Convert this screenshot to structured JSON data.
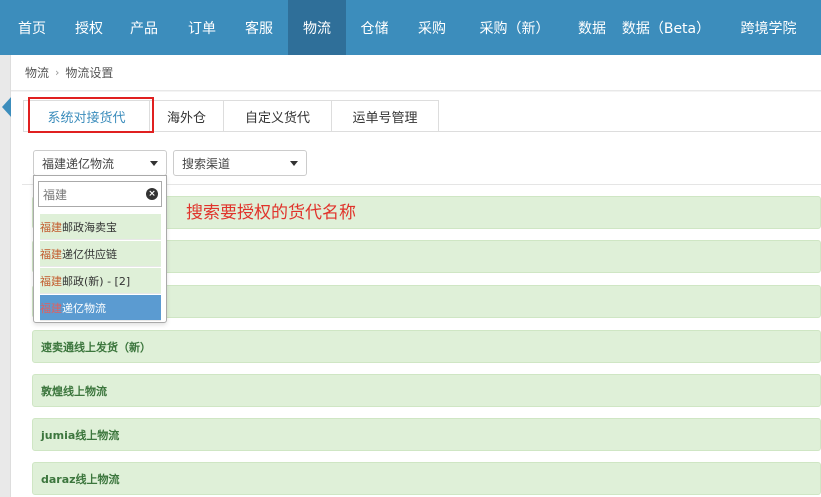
{
  "nav": {
    "items": [
      {
        "label": "首页",
        "active": false
      },
      {
        "label": "授权",
        "active": false
      },
      {
        "label": "产品",
        "active": false
      },
      {
        "label": "订单",
        "active": false
      },
      {
        "label": "客服",
        "active": false
      },
      {
        "label": "物流",
        "active": true
      },
      {
        "label": "仓储",
        "active": false
      },
      {
        "label": "采购",
        "active": false
      },
      {
        "label": "采购（新）",
        "active": false
      },
      {
        "label": "数据",
        "active": false
      },
      {
        "label": "数据（Beta）",
        "active": false
      },
      {
        "label": "跨境学院",
        "active": false
      }
    ]
  },
  "breadcrumb": {
    "root": "物流",
    "current": "物流设置"
  },
  "tabs": [
    "系统对接货代",
    "海外仓",
    "自定义货代",
    "运单号管理"
  ],
  "filters": {
    "carrier_select": "福建递亿物流",
    "channel_select": "搜索渠道"
  },
  "dropdown": {
    "search_value": "福建",
    "options": [
      {
        "highlight": "福建",
        "rest": "邮政海卖宝",
        "selected": false
      },
      {
        "highlight": "福建",
        "rest": "递亿供应链",
        "selected": false
      },
      {
        "highlight": "福建",
        "rest": "邮政(新) - [2]",
        "selected": false
      },
      {
        "highlight": "福建",
        "rest": "递亿物流",
        "selected": true
      }
    ]
  },
  "annotation": "搜索要授权的货代名称",
  "rows": [
    "速卖通线上发货（新）",
    "敦煌线上物流",
    "jumia线上物流",
    "daraz线上物流"
  ],
  "colors": {
    "nav_bg": "#3c8dbc",
    "nav_active": "#2f6f99",
    "row_bg": "#dff0d8",
    "row_text": "#3c763d",
    "highlight_border": "#e02020",
    "annotation": "#e0332b"
  }
}
